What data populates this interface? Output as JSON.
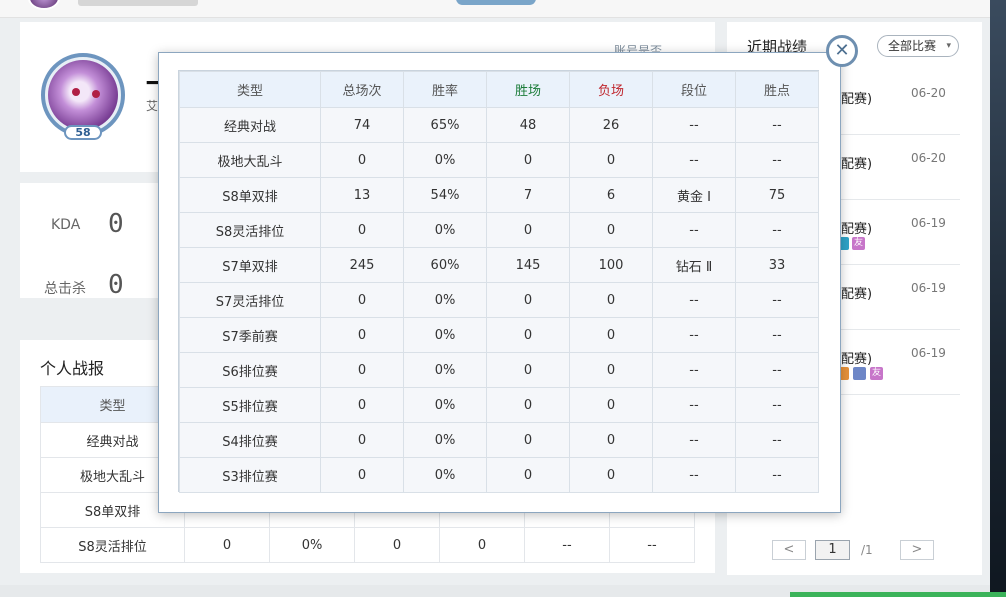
{
  "colors": {
    "win": "#1c7c3a",
    "loss": "#c0282f",
    "accent": "#6d95bf"
  },
  "profile": {
    "level": "58",
    "name_partial": "一",
    "sub_partial": "艾",
    "link_partial": "账号是否..."
  },
  "kda": {
    "kda_label": "KDA",
    "kda_value": "0",
    "kills_label": "总击杀",
    "kills_value": "0"
  },
  "report": {
    "title": "个人战报",
    "header": "类型",
    "rows": [
      {
        "type": "经典对战",
        "cells": [
          "",
          "",
          "",
          "",
          "",
          ""
        ]
      },
      {
        "type": "极地大乱斗",
        "cells": [
          "",
          "",
          "",
          "",
          "",
          ""
        ]
      },
      {
        "type": "S8单双排",
        "cells": [
          "",
          "",
          "",
          "",
          "",
          ""
        ]
      },
      {
        "type": "S8灵活排位",
        "cells": [
          "0",
          "0%",
          "0",
          "0",
          "--",
          "--"
        ]
      }
    ]
  },
  "recent": {
    "title": "近期战绩",
    "filter": "全部比赛",
    "matches": [
      {
        "type": "匹配赛)",
        "date": "06-20"
      },
      {
        "type": "匹配赛)",
        "date": "06-20"
      },
      {
        "type": "匹配赛)",
        "date": "06-19",
        "badge": "友"
      },
      {
        "type": "匹配赛)",
        "date": "06-19"
      },
      {
        "type": "匹配赛)",
        "date": "06-19",
        "badge": "友"
      }
    ],
    "pager": {
      "prev": "<",
      "current": "1",
      "total": "/1",
      "next": ">"
    }
  },
  "modal": {
    "close_icon": "close-icon",
    "headers": [
      "类型",
      "总场次",
      "胜率",
      "胜场",
      "负场",
      "段位",
      "胜点"
    ],
    "rows": [
      [
        "经典对战",
        "74",
        "65%",
        "48",
        "26",
        "--",
        "--"
      ],
      [
        "极地大乱斗",
        "0",
        "0%",
        "0",
        "0",
        "--",
        "--"
      ],
      [
        "S8单双排",
        "13",
        "54%",
        "7",
        "6",
        "黄金 Ⅰ",
        "75"
      ],
      [
        "S8灵活排位",
        "0",
        "0%",
        "0",
        "0",
        "--",
        "--"
      ],
      [
        "S7单双排",
        "245",
        "60%",
        "145",
        "100",
        "钻石 Ⅱ",
        "33"
      ],
      [
        "S7灵活排位",
        "0",
        "0%",
        "0",
        "0",
        "--",
        "--"
      ],
      [
        "S7季前赛",
        "0",
        "0%",
        "0",
        "0",
        "--",
        "--"
      ],
      [
        "S6排位赛",
        "0",
        "0%",
        "0",
        "0",
        "--",
        "--"
      ],
      [
        "S5排位赛",
        "0",
        "0%",
        "0",
        "0",
        "--",
        "--"
      ],
      [
        "S4排位赛",
        "0",
        "0%",
        "0",
        "0",
        "--",
        "--"
      ],
      [
        "S3排位赛",
        "0",
        "0%",
        "0",
        "0",
        "--",
        "--"
      ]
    ]
  }
}
